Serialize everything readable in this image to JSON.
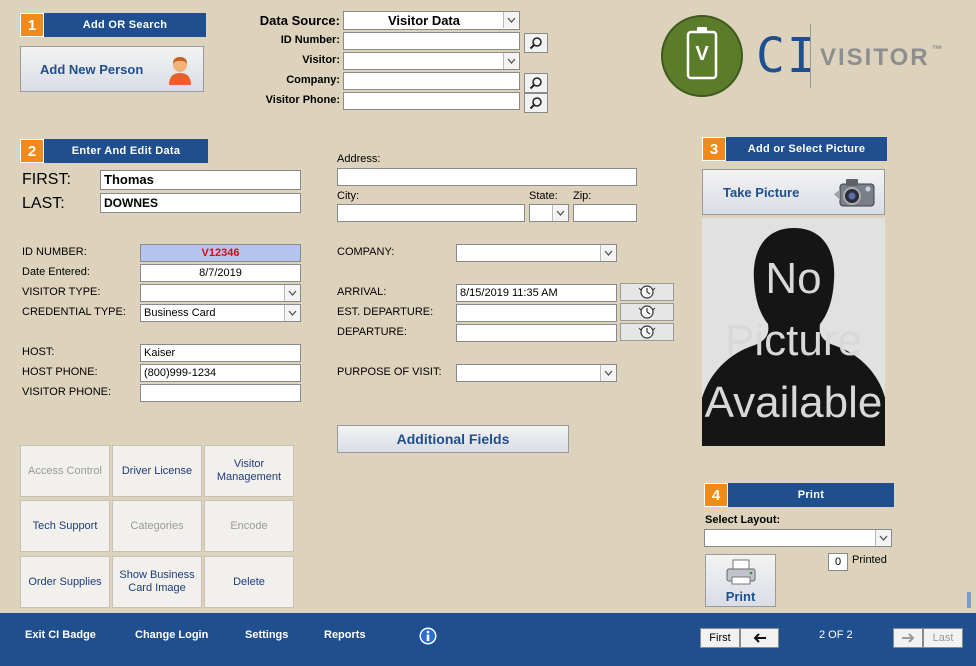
{
  "sections": {
    "s1": {
      "num": "1",
      "title": "Add  OR  Search"
    },
    "s2": {
      "num": "2",
      "title": "Enter  And  Edit  Data"
    },
    "s3": {
      "num": "3",
      "title": "Add or Select Picture"
    },
    "s4": {
      "num": "4",
      "title": "Print"
    }
  },
  "add_new_person": "Add New Person",
  "search": {
    "data_source_label": "Data Source:",
    "data_source_value": "Visitor Data",
    "id_label": "ID Number:",
    "visitor_label": "Visitor:",
    "company_label": "Company:",
    "phone_label": "Visitor Phone:"
  },
  "logo": {
    "ci": "CI",
    "visitor": "VISITOR",
    "tm": "™",
    "badge_letter": "V"
  },
  "person": {
    "first_label": "FIRST:",
    "first": "Thomas",
    "last_label": "LAST:",
    "last": "DOWNES",
    "id_label": "ID NUMBER:",
    "id": "V12346",
    "date_label": "Date Entered:",
    "date": "8/7/2019",
    "vtype_label": "VISITOR TYPE:",
    "vtype": "",
    "cred_label": "CREDENTIAL TYPE:",
    "cred": "Business Card",
    "host_label": "HOST:",
    "host": "Kaiser",
    "host_phone_label": "HOST PHONE:",
    "host_phone": "(800)999-1234",
    "visitor_phone_label": "VISITOR PHONE:",
    "visitor_phone": ""
  },
  "address": {
    "address_label": "Address:",
    "city_label": "City:",
    "state_label": "State:",
    "zip_label": "Zip:"
  },
  "visit": {
    "company_label": "COMPANY:",
    "arrival_label": "ARRIVAL:",
    "arrival": "8/15/2019 11:35 AM",
    "est_departure_label": "EST. DEPARTURE:",
    "departure_label": "DEPARTURE:",
    "purpose_label": "PURPOSE OF VISIT:"
  },
  "additional_fields": "Additional Fields",
  "take_picture": "Take Picture",
  "no_picture": [
    "No",
    "Picture",
    "Available"
  ],
  "grid_buttons": [
    {
      "label": "Access Control",
      "enabled": false
    },
    {
      "label": "Driver License",
      "enabled": true
    },
    {
      "label": "Visitor Management",
      "enabled": true
    },
    {
      "label": "Tech Support",
      "enabled": true
    },
    {
      "label": "Categories",
      "enabled": false
    },
    {
      "label": "Encode",
      "enabled": false
    },
    {
      "label": "Order Supplies",
      "enabled": true
    },
    {
      "label": "Show Business Card Image",
      "enabled": true
    },
    {
      "label": "Delete",
      "enabled": true
    }
  ],
  "print": {
    "select_layout_label": "Select Layout:",
    "printed_count": "0",
    "printed_label": "Printed",
    "button": "Print"
  },
  "footer": {
    "exit": "Exit CI Badge",
    "change_login": "Change Login",
    "settings": "Settings",
    "reports": "Reports",
    "first": "First",
    "record": "2  OF  2",
    "last": "Last"
  },
  "colors": {
    "accent": "#1f4f8e",
    "number_badge": "#f28a1a",
    "id_highlight": "#b6c4f0",
    "id_text": "#d01010",
    "background": "#ddd3bd"
  }
}
